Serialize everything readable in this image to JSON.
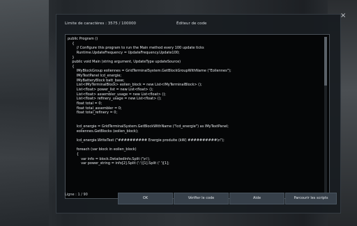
{
  "header": {
    "char_limit": "Limite de caractères : 3575 / 100000",
    "title": "Éditeur de code",
    "close_icon": "×"
  },
  "editor": {
    "lines": [
      "public Program ()",
      "    {",
      "        // Configure this program to run the Main method every 100 update ticks",
      "        Runtime.UpdateFrequency = UpdateFrequency.Update100;",
      "    }",
      "    public void Main (string argument, UpdateType updateSource)",
      "    {",
      "        IMyBlockGroup eoliennes = GridTerminalSystem.GetBlockGroupWithName (\"Eoliennes\");",
      "        IMyTextPanel lcd_energie;",
      "        IMyBatteryBlock batt_base;",
      "        List<IMyTerminalBlock> eolien_block = new List<IMyTerminalBlock> ();",
      "        List<float> power_list = new List<float> ();",
      "        List<float> assembler_usage = new List<float> ();",
      "        List<float> refinery_usage = new List<float> ();",
      "        float total = 0;",
      "        float total_assembler = 0;",
      "        float total_refinery = 0;",
      "",
      "",
      "        lcd_energie = GridTerminalSystem.GetBlockWithName (\"lcd_energie\") as IMyTextPanel;",
      "        eoliennes.GetBlocks (eolien_block);",
      "",
      "        lcd_energie.WriteText (\"########## Energie produite (kW) ##########\\n\");",
      "",
      "        foreach (var block in eolien_block)",
      "        {",
      "            var info = block.DetailedInfo.Split ('\\n');",
      "            var power_string = info[2].Split (':')[1].Split (' ')[1];",
      "",
      "",
      ""
    ]
  },
  "status": {
    "line_info": "Ligne : 1 / 90"
  },
  "buttons": {
    "ok": "OK",
    "check": "Vérifier le code",
    "help": "Aide",
    "browse": "Parcourir les scripts"
  }
}
